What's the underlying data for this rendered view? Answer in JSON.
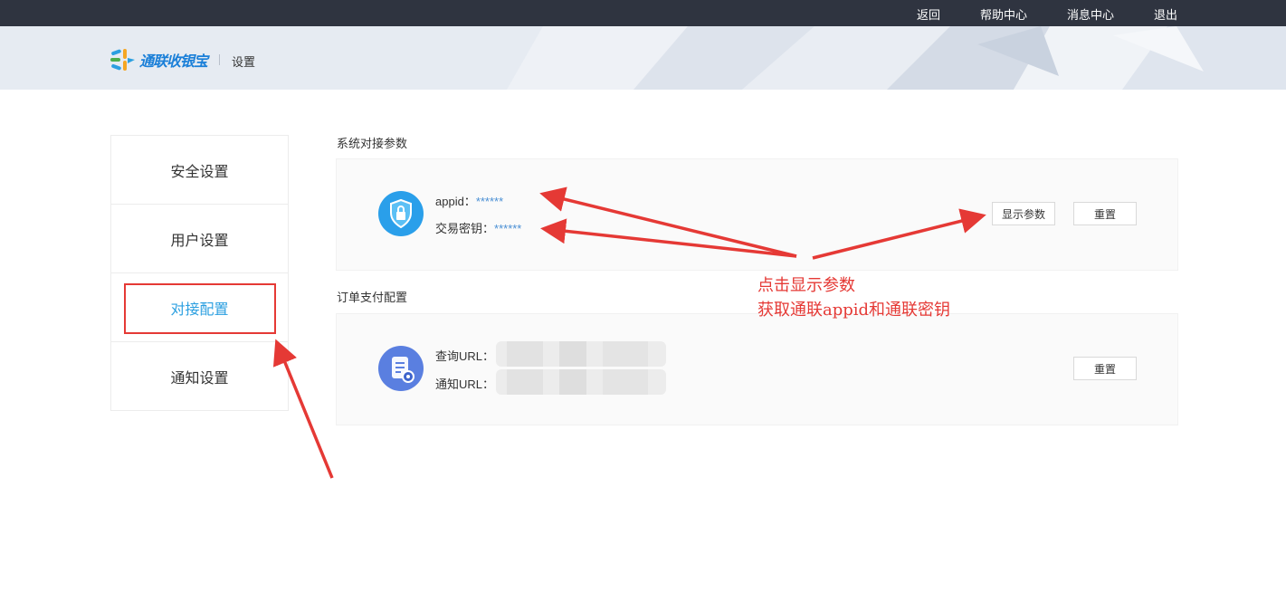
{
  "topbar": {
    "links": [
      "返回",
      "帮助中心",
      "消息中心",
      "退出"
    ]
  },
  "header": {
    "logo_text": "通联收银宝",
    "page_label": "设置"
  },
  "sidebar": {
    "items": [
      {
        "label": "安全设置"
      },
      {
        "label": "用户设置"
      },
      {
        "label": "对接配置",
        "active": true
      },
      {
        "label": "通知设置"
      }
    ]
  },
  "section1": {
    "title": "系统对接参数",
    "appid_label": "appid：",
    "appid_value": "******",
    "key_label": "交易密钥：",
    "key_value": "******",
    "show_button": "显示参数",
    "reset_button": "重置"
  },
  "section2": {
    "title": "订单支付配置",
    "query_label": "查询URL：",
    "notify_label": "通知URL：",
    "reset_button": "重置"
  },
  "annotation": {
    "line1": "点击显示参数",
    "line2": "获取通联appid和通联密钥"
  },
  "colors": {
    "topbar": "#2f3440",
    "accent": "#2b9fe0",
    "annotation_red": "#e53935",
    "masked_value": "#4a8fd4"
  },
  "icons": [
    "shield-lock-icon",
    "doc-settings-icon",
    "logo-icon"
  ]
}
